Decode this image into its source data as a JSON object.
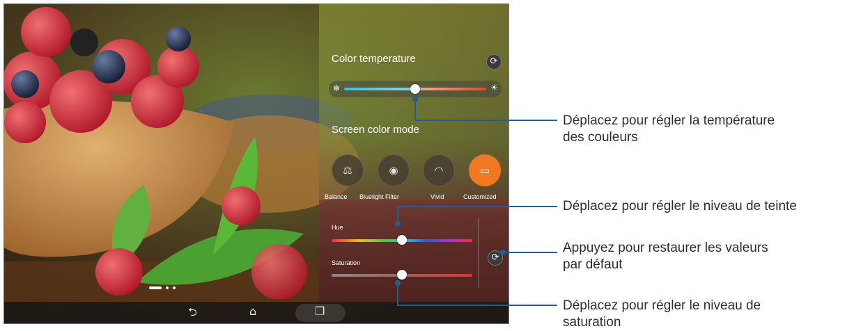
{
  "panel": {
    "color_temperature": {
      "title": "Color temperature",
      "cold_icon": "snowflake-icon",
      "warm_icon": "sun-icon",
      "reset_icon": "refresh-icon",
      "value": 0.5
    },
    "screen_color_mode": {
      "title": "Screen color mode",
      "modes": [
        {
          "label": "Balance",
          "icon": "scale-icon",
          "glyph": "⚖",
          "active": false
        },
        {
          "label": "Bluelight Filter",
          "icon": "eye-shield-icon",
          "glyph": "◉",
          "active": false
        },
        {
          "label": "Vivid",
          "icon": "rainbow-icon",
          "glyph": "◠",
          "active": false
        },
        {
          "label": "Customized",
          "icon": "custom-screen-icon",
          "glyph": "▭",
          "active": true
        }
      ]
    },
    "hue": {
      "label": "Hue",
      "value": 0.5
    },
    "saturation": {
      "label": "Saturation",
      "value": 0.5
    },
    "reset_icon": "refresh-icon"
  },
  "navbar": {
    "back_glyph": "⮌",
    "home_glyph": "⌂",
    "recent_glyph": "❐"
  },
  "callouts": {
    "temperature": [
      "Déplacez pour régler la température",
      "des couleurs"
    ],
    "hue": [
      "Déplacez pour régler le niveau de teinte"
    ],
    "reset": [
      "Appuyez pour restaurer les valeurs",
      "par défaut"
    ],
    "saturation": [
      "Déplacez pour régler le niveau de",
      "saturation"
    ]
  },
  "colors": {
    "accent": "#f07820",
    "callout_line": "#1f5e9a"
  }
}
